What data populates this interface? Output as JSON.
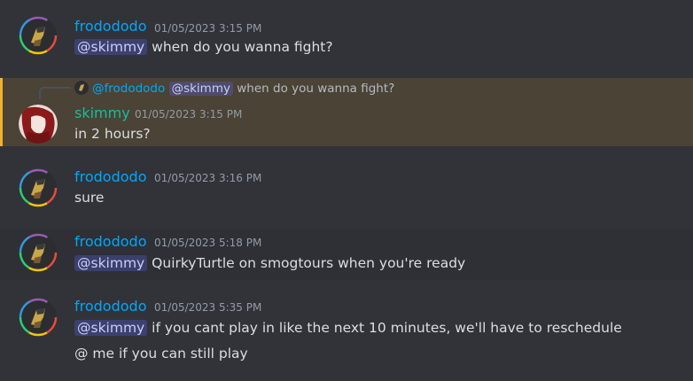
{
  "colors": {
    "frodo_name": "#00a8fc",
    "skimmy_name": "#1abc9c",
    "highlight_bg": "#4a4336",
    "highlight_bar": "#f0b232"
  },
  "messages": [
    {
      "username": "frodododo",
      "timestamp": "01/05/2023 3:15 PM",
      "lines": [
        {
          "mention": "@skimmy",
          "text": "when do you wanna fight?"
        }
      ]
    },
    {
      "reply": {
        "author": "@frodododo",
        "mention": "@skimmy",
        "text": "when do you wanna fight?"
      },
      "username": "skimmy",
      "timestamp": "01/05/2023 3:15 PM",
      "lines": [
        {
          "text": "in 2 hours?"
        }
      ]
    },
    {
      "username": "frodododo",
      "timestamp": "01/05/2023 3:16 PM",
      "lines": [
        {
          "text": "sure"
        }
      ]
    },
    {
      "username": "frodododo",
      "timestamp": "01/05/2023 5:18 PM",
      "lines": [
        {
          "mention": "@skimmy",
          "text": "QuirkyTurtle on smogtours when you're ready"
        }
      ]
    },
    {
      "username": "frodododo",
      "timestamp": "01/05/2023 5:35 PM",
      "lines": [
        {
          "mention": "@skimmy",
          "text": "if you cant play in like the next 10 minutes, we'll have to reschedule"
        },
        {
          "text": "@ me if you can still play"
        }
      ]
    }
  ]
}
